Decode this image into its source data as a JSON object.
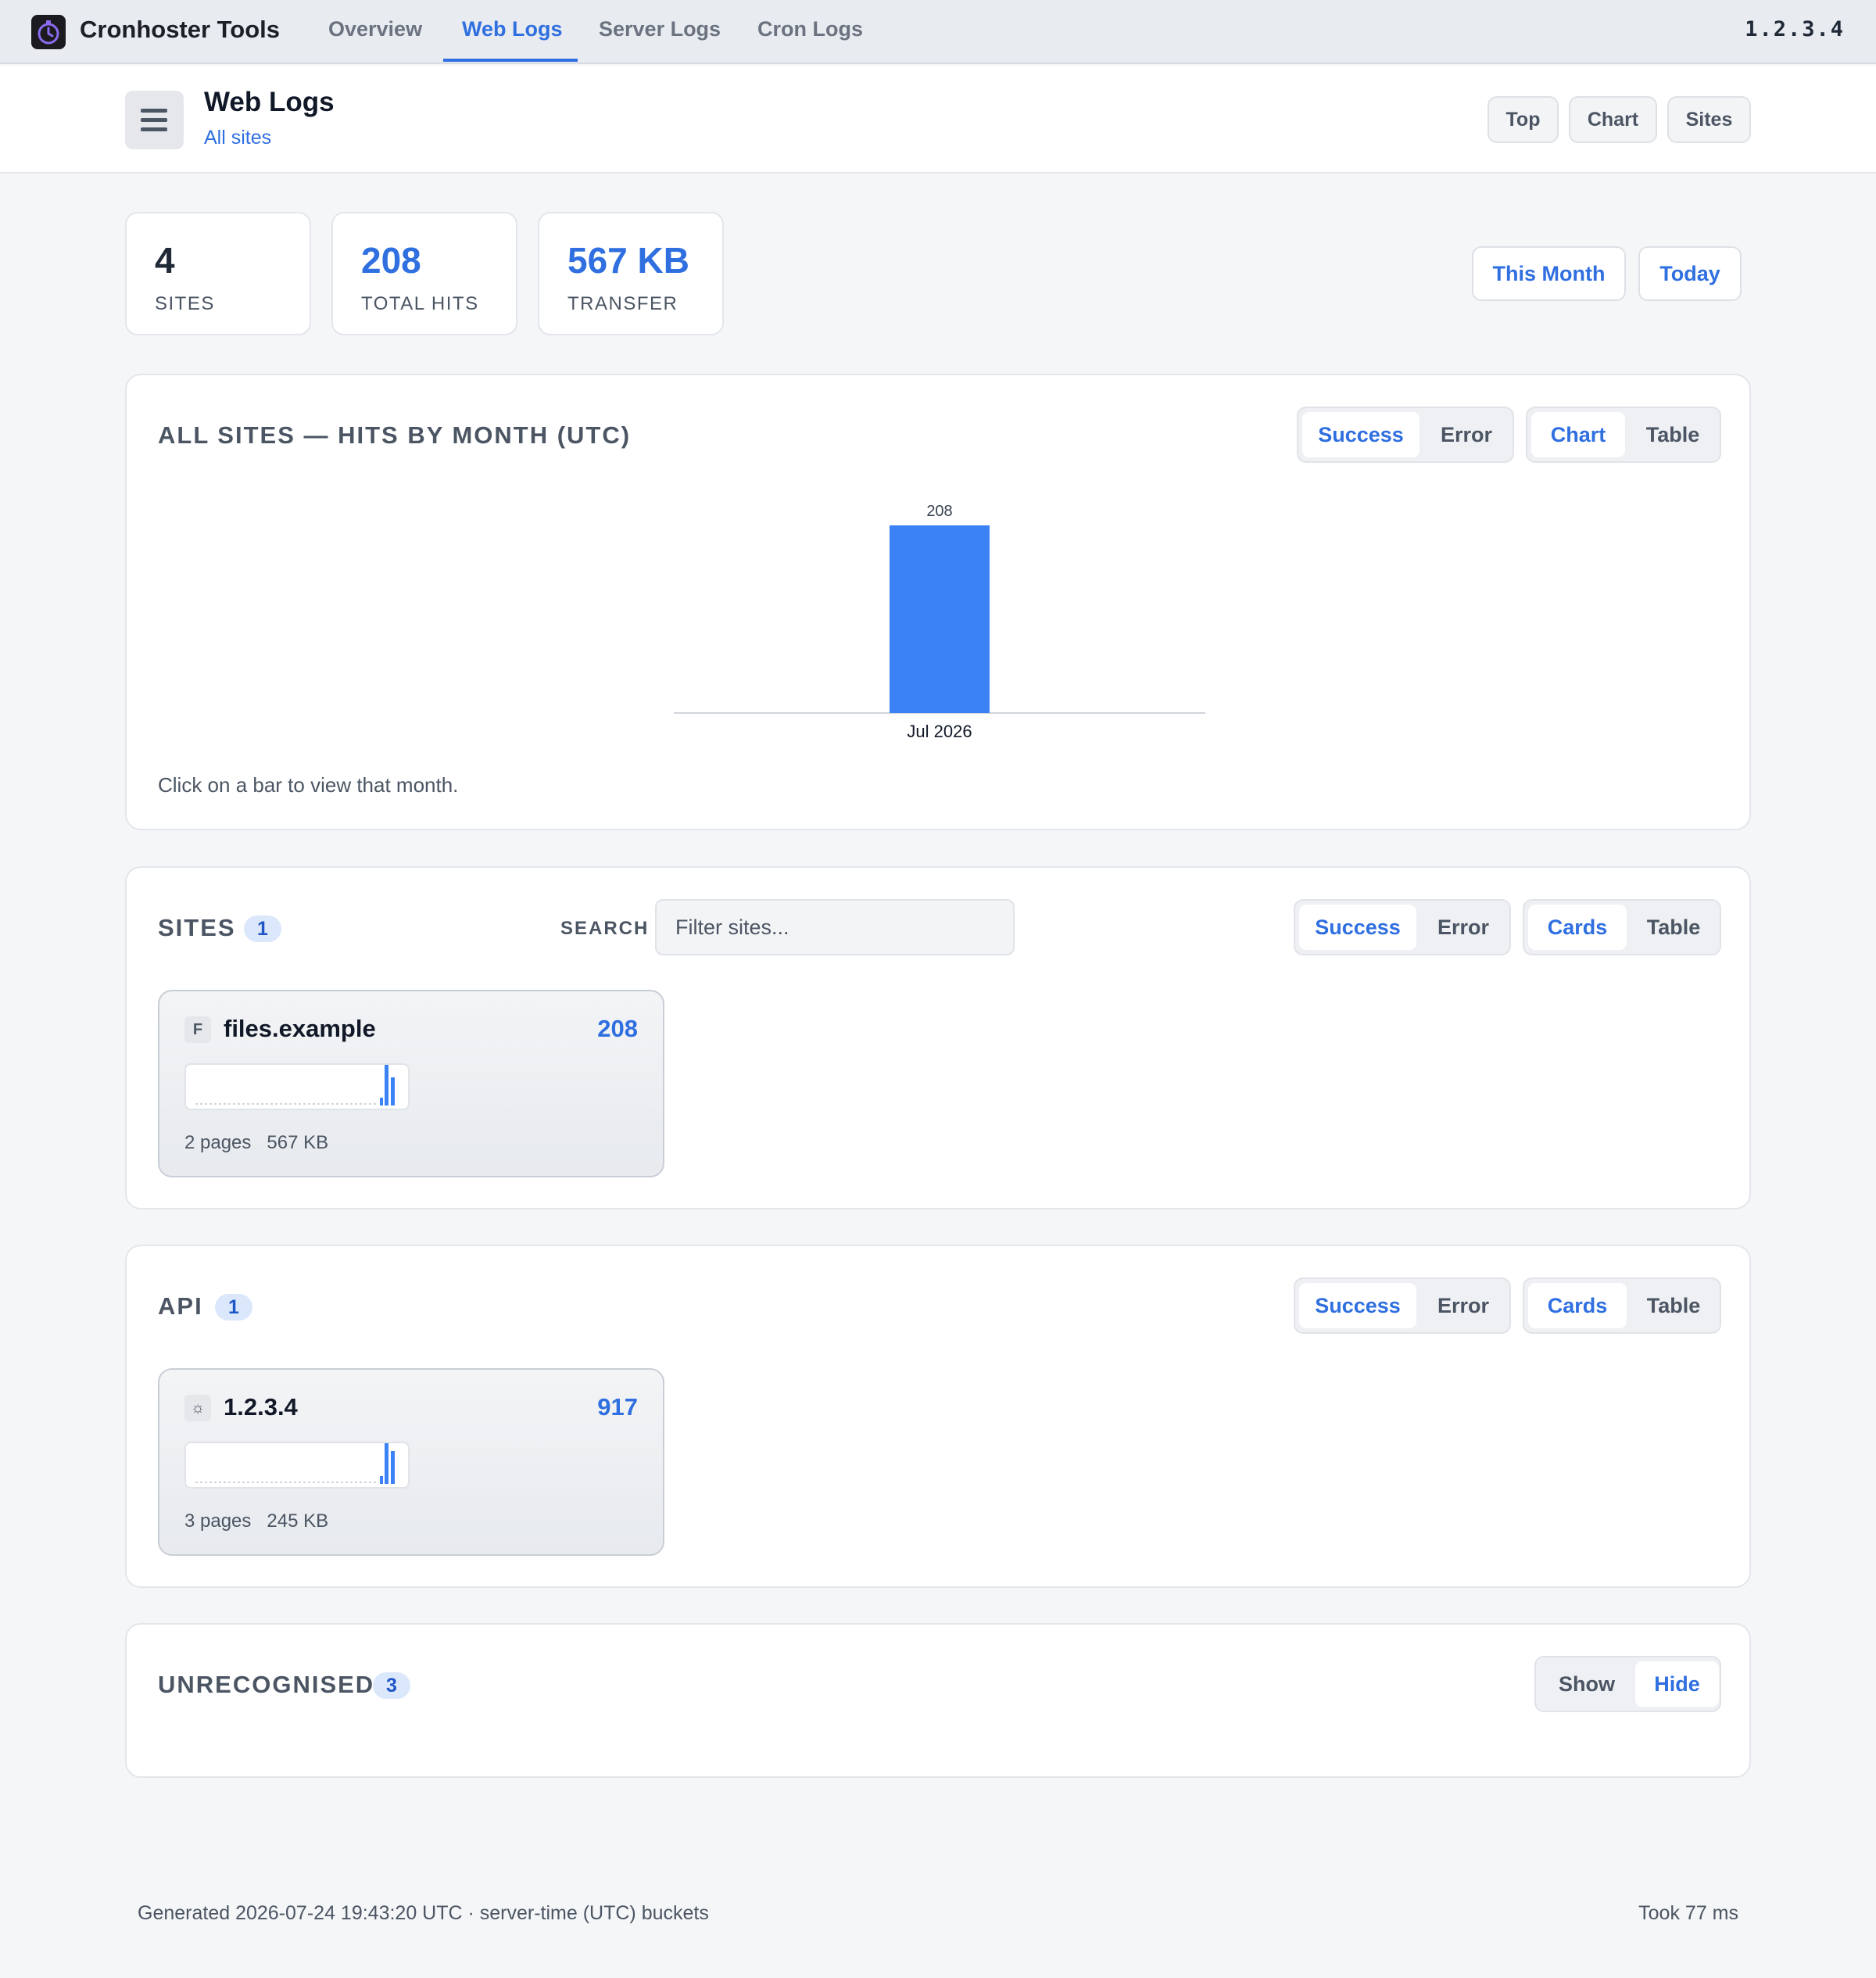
{
  "nav": {
    "brand": "Cronhoster Tools",
    "tabs": [
      "Overview",
      "Web Logs",
      "Server Logs",
      "Cron Logs"
    ],
    "active_tab": "Web Logs",
    "host": "1.2.3.4",
    "logo_icon": "stopwatch-icon"
  },
  "header": {
    "title": "Web Logs",
    "breadcrumb": "All sites",
    "menu_icon": "hamburger-menu-icon",
    "buttons": [
      "Top",
      "Chart",
      "Sites"
    ]
  },
  "stats": [
    {
      "value": "4",
      "label": "SITES",
      "color": "#1f2937"
    },
    {
      "value": "208",
      "label": "TOTAL HITS",
      "color": "#2f6fe0"
    },
    {
      "value": "567 KB",
      "label": "TRANSFER",
      "color": "#2f6fe0"
    }
  ],
  "range_buttons": [
    "This Month",
    "Today"
  ],
  "chart_panel": {
    "title": "ALL SITES — HITS BY MONTH (UTC)",
    "status_toggle": [
      "Success",
      "Error"
    ],
    "view_toggle": [
      "Chart",
      "Table"
    ],
    "hint": "Click on a bar to view that month."
  },
  "chart_data": {
    "type": "bar",
    "categories": [
      "Jul 2026"
    ],
    "values": [
      208
    ],
    "title": "ALL SITES — HITS BY MONTH (UTC)",
    "xlabel": "",
    "ylabel": "",
    "data_labels": true,
    "grid": false,
    "color": "#3b82f6"
  },
  "sites_panel": {
    "title": "SITES",
    "count": "1",
    "search_label": "SEARCH",
    "search_placeholder": "Filter sites...",
    "status_toggle": [
      "Success",
      "Error"
    ],
    "view_toggle": [
      "Cards",
      "Table"
    ],
    "cards": [
      {
        "icon_letter": "F",
        "name": "files.example",
        "hits": "208",
        "pages": "2 pages",
        "size": "567 KB"
      }
    ]
  },
  "api_panel": {
    "title": "API",
    "count": "1",
    "status_toggle": [
      "Success",
      "Error"
    ],
    "view_toggle": [
      "Cards",
      "Table"
    ],
    "cards": [
      {
        "icon_letter": "☼",
        "icon": "gear-icon",
        "name": "1.2.3.4",
        "hits": "917",
        "pages": "3 pages",
        "size": "245 KB"
      }
    ]
  },
  "unrecognised_panel": {
    "title": "UNRECOGNISED",
    "count": "3",
    "toggle": [
      "Show",
      "Hide"
    ],
    "selected": "Hide"
  },
  "footer": {
    "generated": "Generated 2026-07-24 19:43:20 UTC · server-time (UTC) buckets",
    "took": "Took 77 ms"
  }
}
